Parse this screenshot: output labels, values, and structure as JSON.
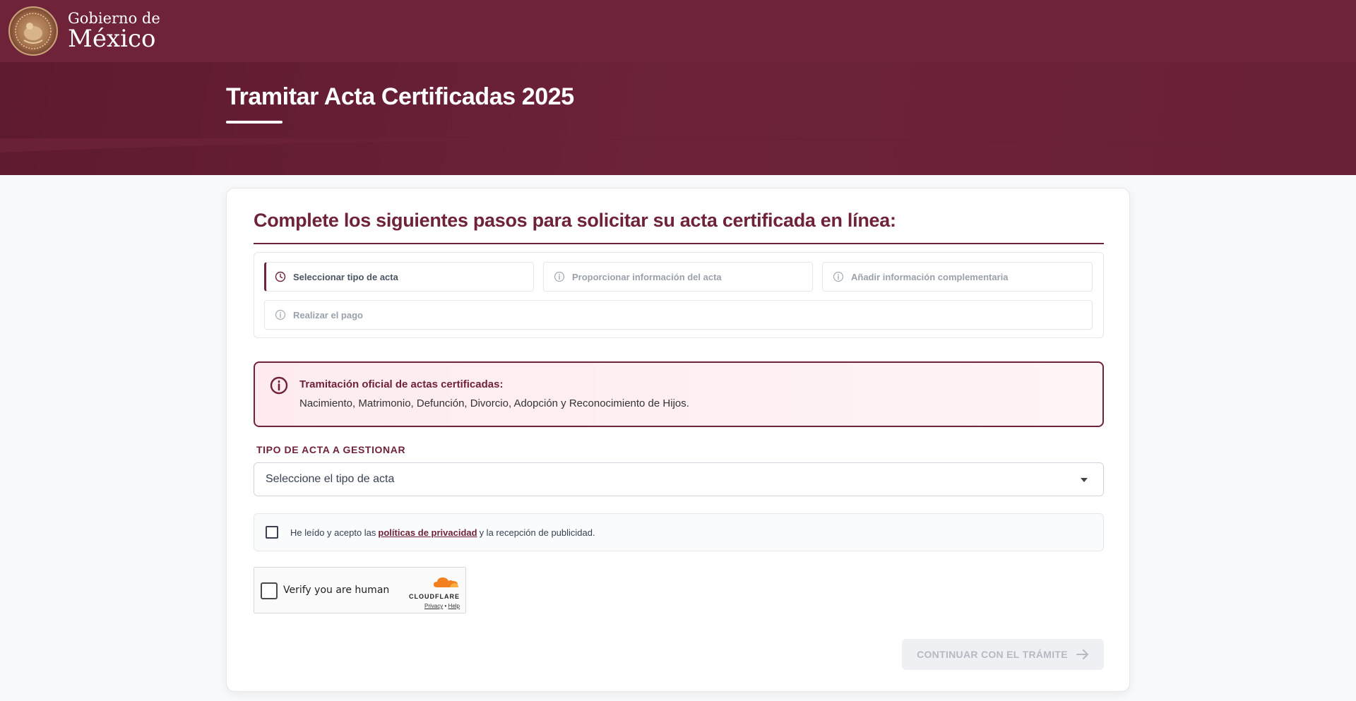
{
  "header": {
    "brand_small": "Gobierno de",
    "brand_big": "México"
  },
  "hero": {
    "title": "Tramitar Acta Certificadas 2025"
  },
  "card": {
    "title": "Complete los siguientes pasos para solicitar su acta certificada en línea:"
  },
  "steps": [
    {
      "label": "Seleccionar tipo de acta",
      "icon": "clock-icon",
      "active": true
    },
    {
      "label": "Proporcionar información del acta",
      "icon": "info-icon",
      "active": false
    },
    {
      "label": "Añadir información complementaria",
      "icon": "info-icon",
      "active": false
    },
    {
      "label": "Realizar el pago",
      "icon": "info-icon",
      "active": false
    }
  ],
  "alert": {
    "title": "Tramitación oficial de actas certificadas:",
    "text": "Nacimiento, Matrimonio, Defunción, Divorcio, Adopción y Reconocimiento de Hijos."
  },
  "form": {
    "type_label": "TIPO DE ACTA A GESTIONAR",
    "type_placeholder": "Seleccione el tipo de acta"
  },
  "consent": {
    "before": "He leído y acepto las",
    "link": "políticas de privacidad",
    "after": "y la recepción de publicidad."
  },
  "captcha": {
    "label": "Verify you are human",
    "brand": "CLOUDFLARE",
    "privacy": "Privacy",
    "separator": "•",
    "help": "Help"
  },
  "actions": {
    "continue_label": "CONTINUAR CON EL TRÁMITE"
  },
  "colors": {
    "brand": "#6f2338",
    "accent_orange": "#f38020"
  }
}
